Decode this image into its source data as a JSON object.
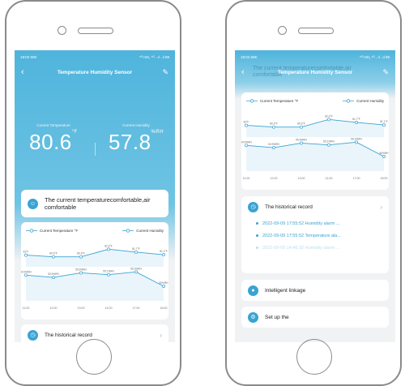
{
  "status_bar": {
    "time": "18:02 60K",
    "icons": "⁵ᴳ HD₁ ⁴ᴳ ..ıl ..ıl 89"
  },
  "header": {
    "back_icon": "back-icon",
    "title": "Temperature Humidity Sensor",
    "edit_icon": "edit-icon"
  },
  "readings": {
    "temperature": {
      "label": "Current Temperature",
      "value": "80.6",
      "unit": "°F"
    },
    "humidity": {
      "label": "Current Humidity",
      "value": "57.8",
      "unit": "%RH"
    }
  },
  "comfort": {
    "text": "The current temperaturecomfortable,air comfortable"
  },
  "chart": {
    "legend_temperature": "Current Temperature °F",
    "legend_humidity": "Current Humidity"
  },
  "chart_data": {
    "type": "line",
    "categories": [
      "11:00",
      "12:00",
      "13:00",
      "14:00",
      "17:00",
      "18:00"
    ],
    "series": [
      {
        "name": "Current Temperature °F",
        "values": [
          81,
          80.6,
          80.6,
          82.4,
          81.7,
          81.1
        ],
        "labels": [
          "81°F",
          "80.6°F",
          "80.6°F",
          "82.4°F",
          "81.7°F",
          "81.1°F"
        ]
      },
      {
        "name": "Current Humidity",
        "values": [
          54.9,
          53.9,
          55.9,
          55.1,
          56.3,
          50
        ],
        "labels": [
          "54.9%RH",
          "53.9%RH",
          "55.9%RH",
          "55.1%RH",
          "56.3%RH",
          "50%RH"
        ]
      }
    ],
    "colors": {
      "temperature": "#3aa3d2",
      "humidity": "#3aa3d2"
    }
  },
  "historical": {
    "title": "The historical record",
    "records": [
      "2022-09-09 17:55:52 Humidity alarm ...",
      "2022-09-09 17:55:52 Temperature ala...",
      "2022-09-09 14:46:32 Humidity alarm ..."
    ]
  },
  "intelligent": {
    "label": "Intelligent linkage"
  },
  "setup": {
    "label": "Set up the"
  },
  "colors": {
    "accent": "#3aa3d2",
    "header_gradient_top": "#4fb4dc",
    "background": "#f1f2f4"
  }
}
